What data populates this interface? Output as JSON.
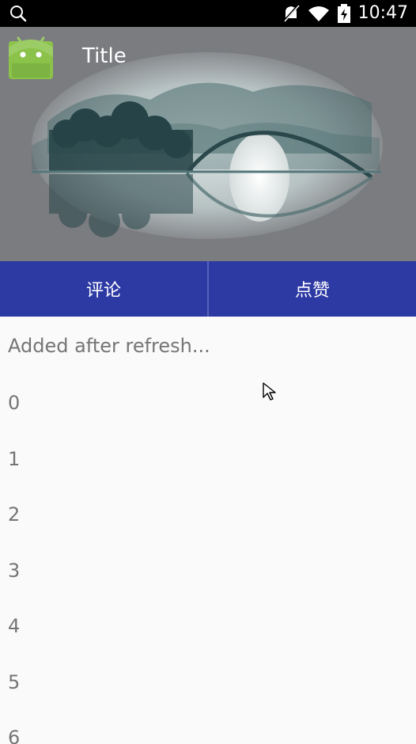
{
  "status_bar": {
    "time": "10:47",
    "icons": [
      "search-icon",
      "mute-icon",
      "wifi-icon",
      "battery-icon"
    ]
  },
  "toolbar": {
    "title": "Title"
  },
  "tabs": [
    {
      "label": "评论"
    },
    {
      "label": "点赞"
    }
  ],
  "list": {
    "header": "Added after refresh...",
    "items": [
      "0",
      "1",
      "2",
      "3",
      "4",
      "5",
      "6"
    ]
  },
  "colors": {
    "tab_bar": "#2e3aa4",
    "header_bg": "#7b7c80",
    "status_bar": "#000000",
    "text_secondary": "#757575"
  }
}
